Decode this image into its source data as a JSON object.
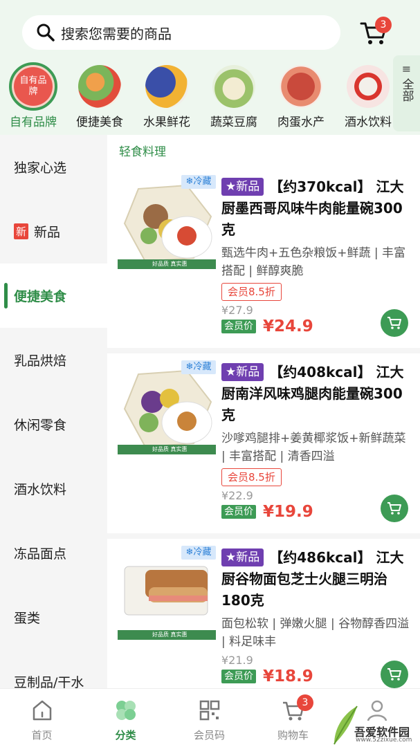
{
  "search": {
    "placeholder": "搜索您需要的商品"
  },
  "cart_badge": "3",
  "categories": [
    {
      "label": "自有品牌",
      "inner": "自有品牌"
    },
    {
      "label": "便捷美食"
    },
    {
      "label": "水果鲜花"
    },
    {
      "label": "蔬菜豆腐"
    },
    {
      "label": "肉蛋水产"
    },
    {
      "label": "酒水饮料"
    }
  ],
  "all_button": {
    "icon": "≡",
    "label": "全部"
  },
  "sidebar": {
    "items": [
      {
        "label": "独家心选"
      },
      {
        "label": "新品",
        "tag": "新"
      },
      {
        "label": "便捷美食"
      },
      {
        "label": "乳品烘焙"
      },
      {
        "label": "休闲零食"
      },
      {
        "label": "酒水饮料"
      },
      {
        "label": "冻品面点"
      },
      {
        "label": "蛋类"
      },
      {
        "label": "豆制品/干水"
      }
    ]
  },
  "section_title": "轻食料理",
  "products": [
    {
      "cold_tag": "❄冷藏",
      "badge": "★新品",
      "title": "【约370kcal】 江大厨墨西哥风味牛肉能量碗300克",
      "desc": "甄选牛肉+五色杂粮饭+鲜蔬 | 丰富搭配 | 鲜醇爽脆",
      "discount": "会员8.5折",
      "orig_price": "¥27.9",
      "member_tag": "会员价",
      "member_price": "¥24.9",
      "img_footer": "好品质 真实惠"
    },
    {
      "cold_tag": "❄冷藏",
      "badge": "★新品",
      "title": "【约408kcal】 江大厨南洋风味鸡腿肉能量碗300克",
      "desc": "沙嗲鸡腿排+姜黄椰浆饭+新鲜蔬菜 | 丰富搭配 | 清香四溢",
      "discount": "会员8.5折",
      "orig_price": "¥22.9",
      "member_tag": "会员价",
      "member_price": "¥19.9",
      "img_footer": "好品质 真实惠"
    },
    {
      "cold_tag": "❄冷藏",
      "badge": "★新品",
      "title": "【约486kcal】 江大厨谷物面包芝士火腿三明治180克",
      "desc": "面包松软 | 弹嫩火腿 | 谷物醇香四溢 | 料足味丰",
      "orig_price": "¥21.9",
      "member_tag": "会员价",
      "member_price": "¥18.9",
      "img_footer": "好品质 真实惠"
    }
  ],
  "bottom_nav": [
    {
      "label": "首页"
    },
    {
      "label": "分类"
    },
    {
      "label": "会员码"
    },
    {
      "label": "购物车",
      "badge": "3"
    },
    {
      "label": ""
    }
  ],
  "watermark": {
    "text": "吾爱软件园",
    "sub": "www.52zixue.com"
  },
  "colors": {
    "accent": "#2f8d48",
    "price": "#e8463b",
    "new_badge": "#6f3fb0",
    "background_top": "#eef7ef"
  }
}
